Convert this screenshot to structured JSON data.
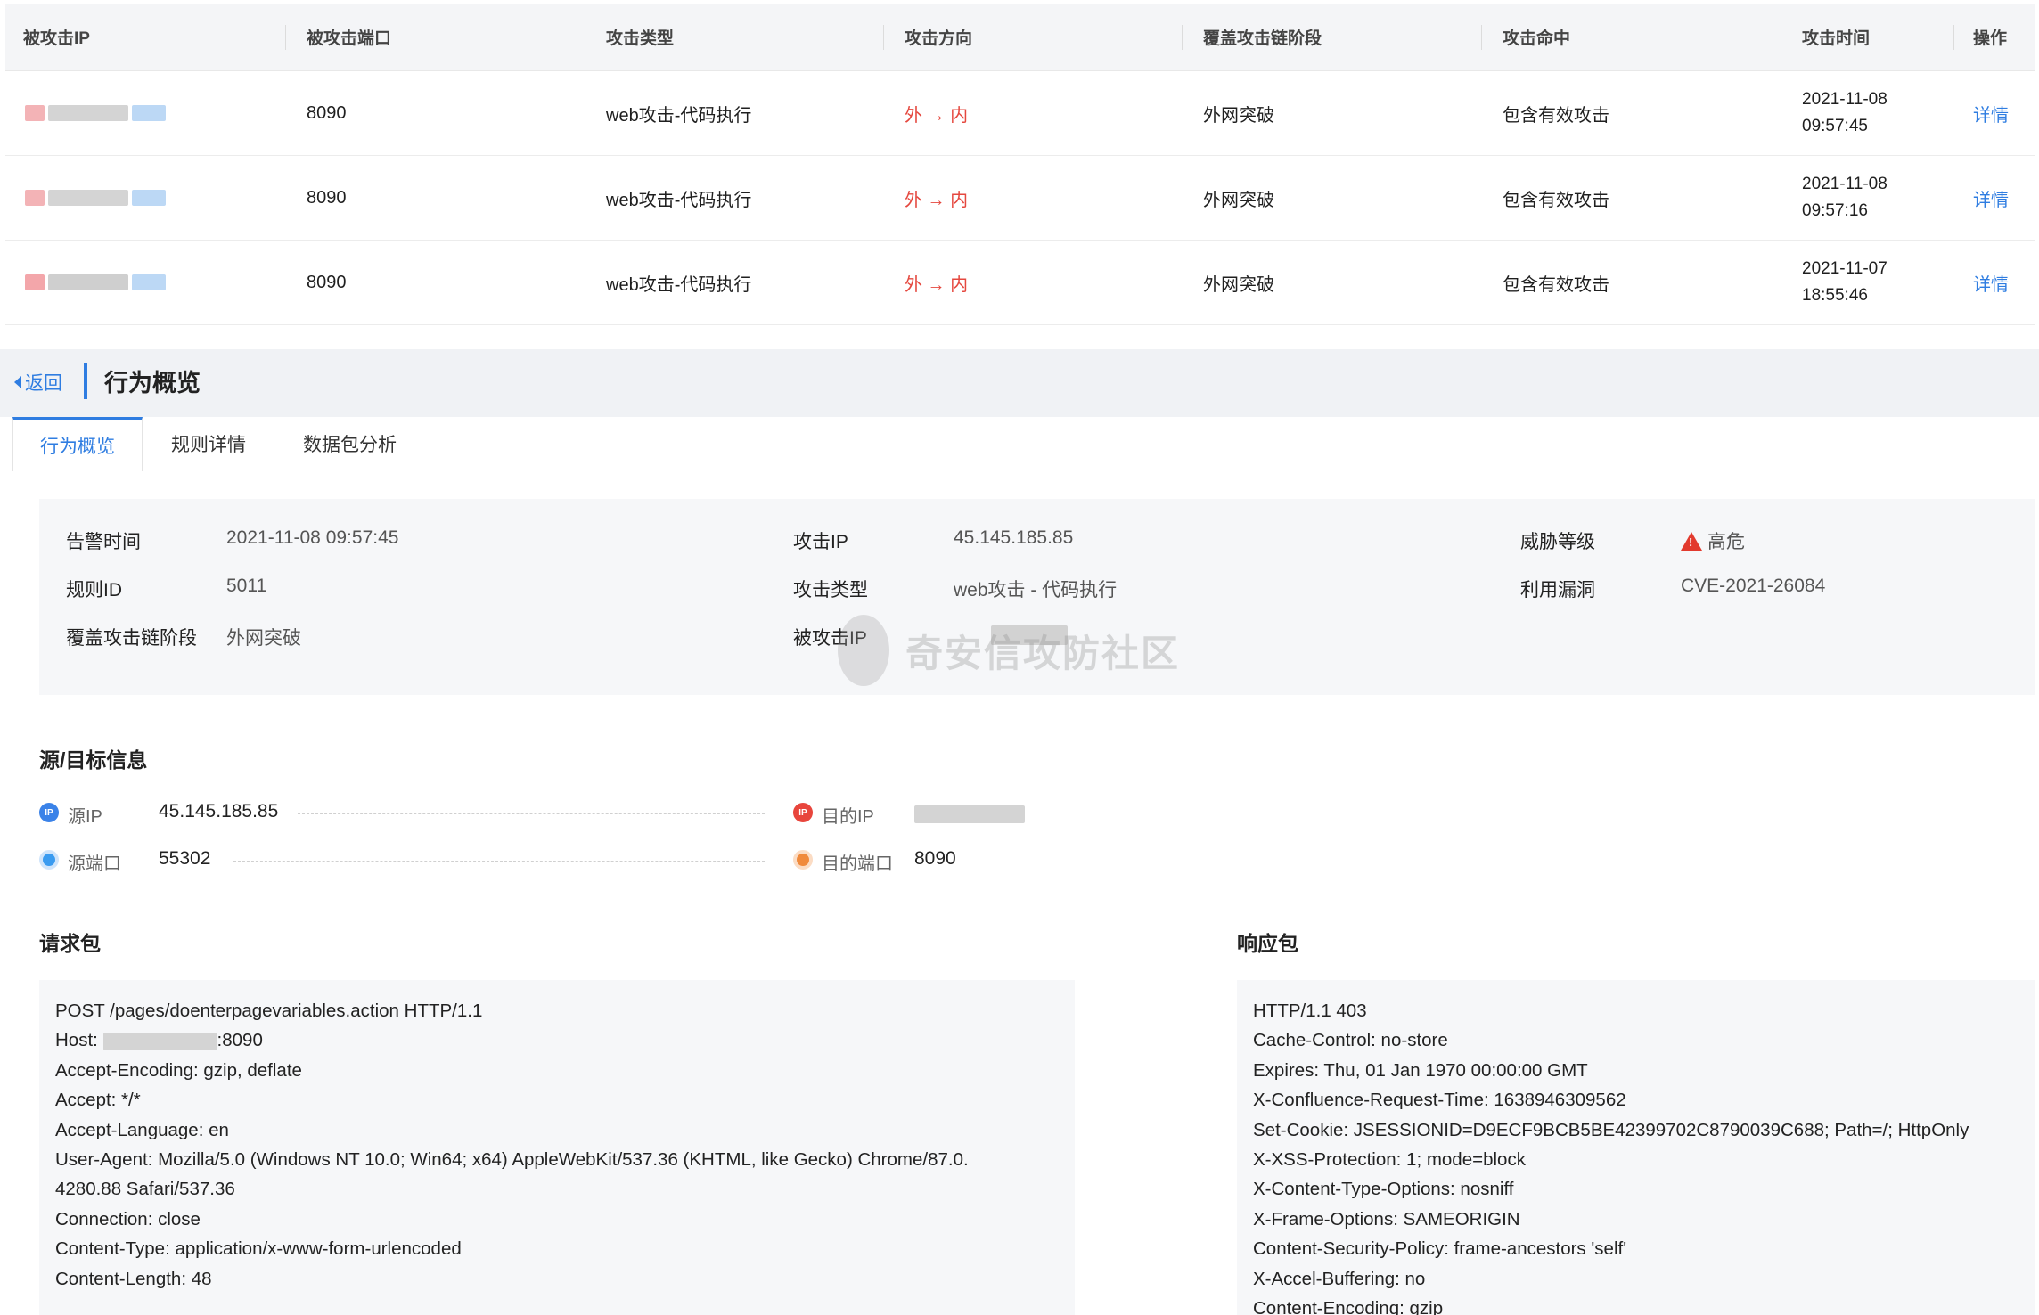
{
  "table": {
    "headers": [
      "被攻击IP",
      "被攻击端口",
      "攻击类型",
      "攻击方向",
      "覆盖攻击链阶段",
      "攻击命中",
      "攻击时间",
      "操作"
    ],
    "rows": [
      {
        "port": "8090",
        "type": "web攻击-代码执行",
        "direction": "外 → 内",
        "stage": "外网突破",
        "hit": "包含有效攻击",
        "date": "2021-11-08",
        "time": "09:57:45",
        "action": "详情"
      },
      {
        "port": "8090",
        "type": "web攻击-代码执行",
        "direction": "外 → 内",
        "stage": "外网突破",
        "hit": "包含有效攻击",
        "date": "2021-11-08",
        "time": "09:57:16",
        "action": "详情"
      },
      {
        "port": "8090",
        "type": "web攻击-代码执行",
        "direction": "外 → 内",
        "stage": "外网突破",
        "hit": "包含有效攻击",
        "date": "2021-11-07",
        "time": "18:55:46",
        "action": "详情"
      }
    ]
  },
  "header": {
    "back_label": "返回",
    "title": "行为概览"
  },
  "tabs": [
    "行为概览",
    "规则详情",
    "数据包分析"
  ],
  "overview": {
    "alert_time_label": "告警时间",
    "alert_time": "2021-11-08 09:57:45",
    "rule_id_label": "规则ID",
    "rule_id": "5011",
    "stage_label": "覆盖攻击链阶段",
    "stage": "外网突破",
    "attack_ip_label": "攻击IP",
    "attack_ip": "45.145.185.85",
    "attack_type_label": "攻击类型",
    "attack_type": "web攻击 - 代码执行",
    "victim_ip_label": "被攻击IP",
    "threat_label": "威胁等级",
    "threat": "高危",
    "vuln_label": "利用漏洞",
    "vuln": "CVE-2021-26084"
  },
  "watermark": "奇安信攻防社区",
  "source_target": {
    "title": "源/目标信息",
    "src_ip_label": "源IP",
    "src_ip": "45.145.185.85",
    "src_port_label": "源端口",
    "src_port": "55302",
    "dst_ip_label": "目的IP",
    "dst_port_label": "目的端口",
    "dst_port": "8090",
    "ip_icon_text": "IP"
  },
  "request": {
    "title": "请求包",
    "lines": [
      "POST /pages/doenterpagevariables.action HTTP/1.1",
      "Host: ",
      "Accept-Encoding: gzip, deflate",
      "Accept: */*",
      "Accept-Language: en",
      "User-Agent: Mozilla/5.0 (Windows NT 10.0; Win64; x64) AppleWebKit/537.36 (KHTML, like Gecko) Chrome/87.0.",
      "4280.88 Safari/537.36",
      "Connection: close",
      "Content-Type: application/x-www-form-urlencoded",
      "Content-Length: 48"
    ],
    "host_suffix": ":8090"
  },
  "response": {
    "title": "响应包",
    "lines": [
      "HTTP/1.1 403",
      "Cache-Control: no-store",
      "Expires: Thu, 01 Jan 1970 00:00:00 GMT",
      "X-Confluence-Request-Time: 1638946309562",
      "Set-Cookie: JSESSIONID=D9ECF9BCB5BE42399702C8790039C688; Path=/; HttpOnly",
      "X-XSS-Protection: 1; mode=block",
      "X-Content-Type-Options: nosniff",
      "X-Frame-Options: SAMEORIGIN",
      "Content-Security-Policy: frame-ancestors 'self'",
      "X-Accel-Buffering: no",
      "Content-Encoding: gzip"
    ]
  },
  "colors": {
    "accent": "#2f7de1",
    "danger": "#e5483f",
    "src_icon": "#3a82e8",
    "dst_icon_ip": "#e8453c",
    "dst_icon_port": "#f08a3c"
  }
}
